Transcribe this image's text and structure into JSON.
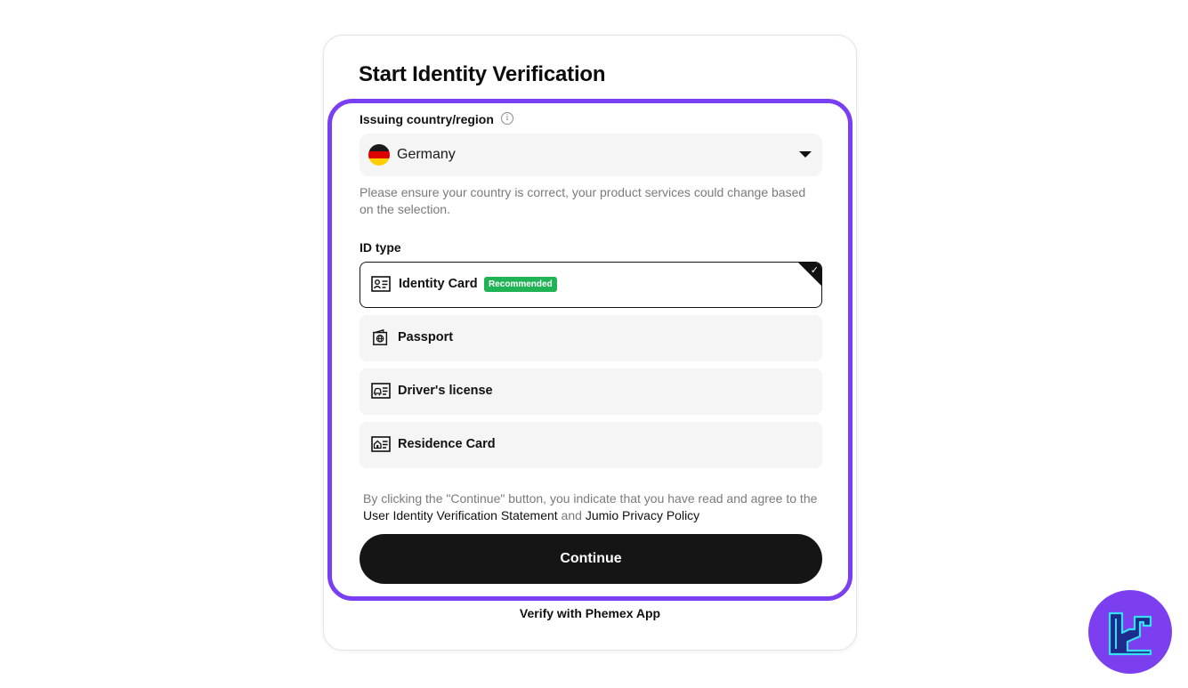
{
  "page": {
    "title": "Start Identity Verification"
  },
  "country": {
    "label": "Issuing country/region",
    "info_icon": "info-circle-icon",
    "selected": "Germany",
    "flag_icon": "germany-flag-icon",
    "hint": "Please ensure your country is correct, your product services could change based on the selection."
  },
  "id_type": {
    "label": "ID type",
    "options": [
      {
        "label": "Identity Card",
        "icon": "id-card-icon",
        "badge": "Recommended",
        "selected": true
      },
      {
        "label": "Passport",
        "icon": "passport-icon",
        "selected": false
      },
      {
        "label": "Driver's license",
        "icon": "drivers-license-icon",
        "selected": false
      },
      {
        "label": "Residence Card",
        "icon": "residence-card-icon",
        "selected": false
      }
    ]
  },
  "terms": {
    "prefix": "By clicking the \"Continue\" button, you indicate that you have read and agree to the ",
    "link1": "User Identity Verification Statement",
    "middle": " and ",
    "link2": "Jumio Privacy Policy"
  },
  "actions": {
    "continue_label": "Continue",
    "app_link": "Verify with Phemex App"
  },
  "colors": {
    "accent": "#7a3ff2",
    "recommended_badge": "#1fb355",
    "button": "#151515"
  }
}
